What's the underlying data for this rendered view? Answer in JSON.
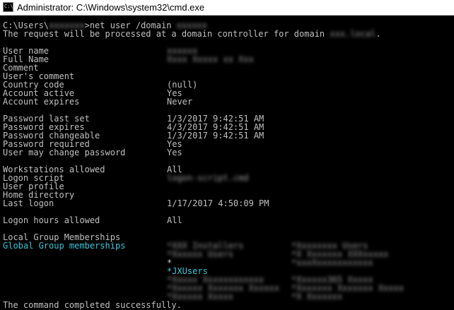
{
  "window": {
    "icon_text": "C:\\",
    "title": "Administrator: C:\\Windows\\system32\\cmd.exe"
  },
  "console": {
    "prompt_prefix": "C:\\Users\\",
    "prompt_user": "xxxxxxx",
    "command": ">net user /domain ",
    "command_arg": "xxxxxx",
    "request_text": "The request will be processed at a domain controller for domain ",
    "request_domain": "xxx.local",
    "request_end": ".",
    "fields": {
      "user_name": {
        "label": "User name",
        "value": "xxxxxx"
      },
      "full_name": {
        "label": "Full Name",
        "value": "Xxxx Xxxxx xx Xxx"
      },
      "comment": {
        "label": "Comment",
        "value": ""
      },
      "users_comment": {
        "label": "User's comment",
        "value": ""
      },
      "country_code": {
        "label": "Country code",
        "value": "(null)"
      },
      "account_active": {
        "label": "Account active",
        "value": "Yes"
      },
      "account_expires": {
        "label": "Account expires",
        "value": "Never"
      },
      "password_last_set": {
        "label": "Password last set",
        "value": "1/3/2017 9:42:51 AM"
      },
      "password_expires": {
        "label": "Password expires",
        "value": "4/3/2017 9:42:51 AM"
      },
      "password_changeable": {
        "label": "Password changeable",
        "value": "1/3/2017 9:42:51 AM"
      },
      "password_required": {
        "label": "Password required",
        "value": "Yes"
      },
      "user_may_change_password": {
        "label": "User may change password",
        "value": "Yes"
      },
      "workstations_allowed": {
        "label": "Workstations allowed",
        "value": "All"
      },
      "logon_script": {
        "label": "Logon script",
        "value": "logon-script.cmd"
      },
      "user_profile": {
        "label": "User profile",
        "value": ""
      },
      "home_directory": {
        "label": "Home directory",
        "value": ""
      },
      "last_logon": {
        "label": "Last logon",
        "value": "1/17/2017 4:50:09 PM"
      },
      "logon_hours_allowed": {
        "label": "Logon hours allowed",
        "value": "All"
      },
      "local_group_memberships": {
        "label": "Local Group Memberships",
        "value": ""
      },
      "global_group_memberships": {
        "label": "Global Group memberships",
        "value": ""
      }
    },
    "groups": [
      {
        "left": "*XXX Installers",
        "right": "*Xxxxxxxx Users"
      },
      {
        "left": "*Xxxxxx Users",
        "right": "*X Xxxxxxx XXXxxxxx"
      },
      {
        "left": "*",
        "right": "*xxxXxxxxxxxxxxx"
      },
      {
        "left": "*JXUsers",
        "right": ""
      },
      {
        "left": "*Xxxxx Xxxxxxxxxxxx",
        "right": "*Xxxxxx365 Xxxxx"
      },
      {
        "left": "*Xxxxxx Xxxxxxx Xxxxxx",
        "right": "*Xxxxxxx Xxxxxxx Xxxxx"
      },
      {
        "left": "*Xxxxxx Xxxxx",
        "right": "*X Xxxxxxx"
      }
    ],
    "completed": "The command completed successfully.",
    "colors": {
      "text": "#c0c0c0",
      "highlight": "#36c7d6",
      "background": "#000000"
    }
  }
}
